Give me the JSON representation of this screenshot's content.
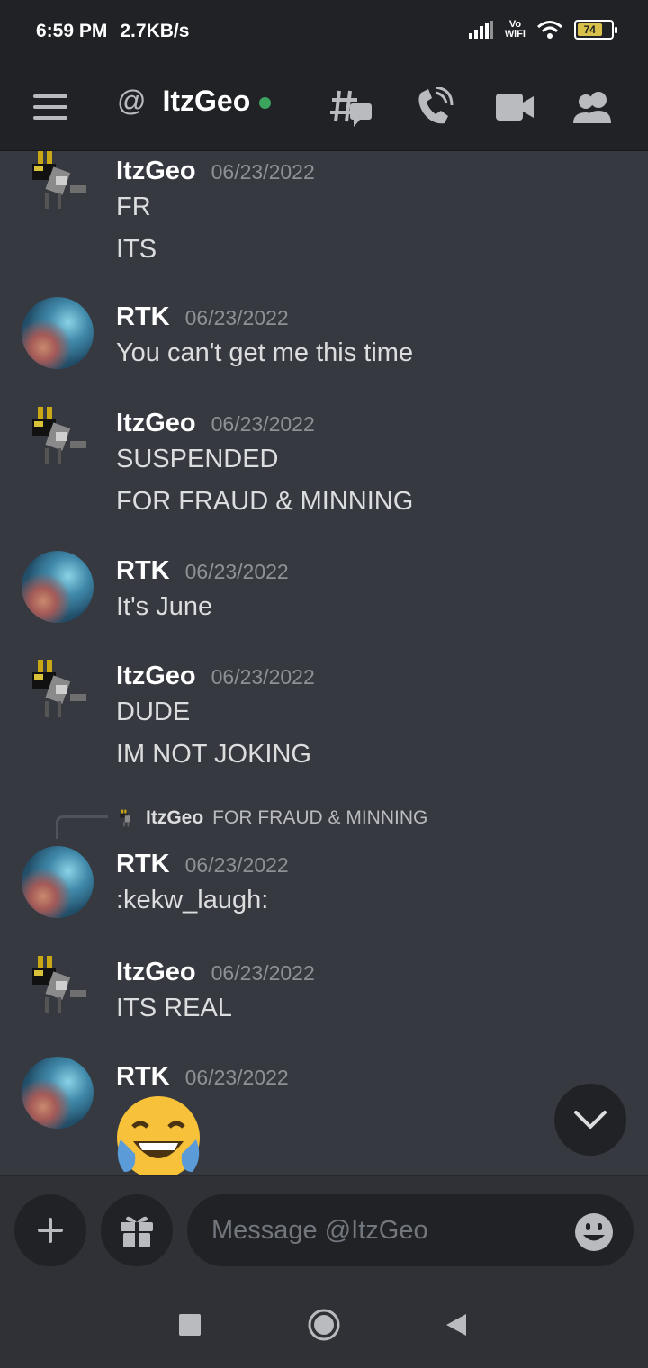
{
  "status_bar": {
    "time": "6:59 PM",
    "speed": "2.7KB/s",
    "vowifi_top": "Vo",
    "vowifi_bottom": "WiFi",
    "battery": "74",
    "battery_level": 0.74
  },
  "header": {
    "at_symbol": "@",
    "title": "ItzGeo",
    "online_color": "#3ba55d"
  },
  "messages": [
    {
      "author": "ItzGeo",
      "timestamp": "06/23/2022",
      "lines": [
        "FR",
        "ITS"
      ]
    },
    {
      "author": "RTK",
      "timestamp": "06/23/2022",
      "lines": [
        "You can't get me this time"
      ]
    },
    {
      "author": "ItzGeo",
      "timestamp": "06/23/2022",
      "lines": [
        "SUSPENDED",
        "FOR FRAUD & MINNING"
      ]
    },
    {
      "author": "RTK",
      "timestamp": "06/23/2022",
      "lines": [
        "It's June"
      ]
    },
    {
      "author": "ItzGeo",
      "timestamp": "06/23/2022",
      "lines": [
        "DUDE",
        "IM NOT JOKING"
      ]
    },
    {
      "author": "RTK",
      "timestamp": "06/23/2022",
      "lines": [
        ":kekw_laugh:"
      ],
      "reply": {
        "author": "ItzGeo",
        "text": "FOR FRAUD & MINNING"
      }
    },
    {
      "author": "ItzGeo",
      "timestamp": "06/23/2022",
      "lines": [
        "ITS REAL"
      ]
    },
    {
      "author": "RTK",
      "timestamp": "06/23/2022",
      "lines": [],
      "emoji": "joy-emoji"
    }
  ],
  "composer": {
    "placeholder": "Message @ItzGeo"
  },
  "icons": {
    "menu": "hamburger-icon",
    "threads": "threads-icon",
    "call": "phone-call-icon",
    "video": "video-icon",
    "members": "members-icon",
    "add": "plus-icon",
    "gift": "gift-icon",
    "emoji": "emoji-smile-icon",
    "jump": "chevron-down-icon"
  },
  "colors": {
    "background": "#36393f",
    "header": "#202225",
    "online": "#3ba55d",
    "text": "#dcddde",
    "muted": "#8e9297"
  }
}
